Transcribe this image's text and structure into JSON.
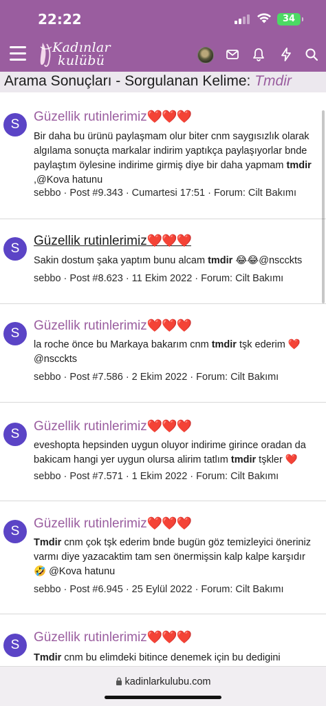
{
  "status": {
    "time": "22:22",
    "battery": "34"
  },
  "header": {
    "logo_line1": "Kadınlar",
    "logo_line2": "kulübü"
  },
  "page": {
    "title_prefix": "Arama Sonuçları - Sorgulanan Kelime: ",
    "search_term": "Tmdir"
  },
  "results": [
    {
      "avatar_letter": "S",
      "title": "Güzellik rutinlerimiz",
      "hearts": "❤️❤️❤️",
      "snippet_before": "Bir daha bu ürünü paylaşmam olur biter cnm saygısızlık olarak algılama sonuçta markalar indirim yaptıkça paylaşıyorlar bnde paylaştım öylesine indirime girmiş diye bir daha yapmam ",
      "snippet_bold": "tmdir",
      "snippet_after": " ,@Kova hatunu",
      "meta": "sebbo · Post #9.343 · Cumartesi 17:51 · Forum: Cilt Bakımı"
    },
    {
      "avatar_letter": "S",
      "title": "Güzellik rutinlerimiz",
      "hearts": "❤️❤️❤️",
      "snippet_before": "Sakin dostum şaka yaptım bunu alcam ",
      "snippet_bold": "tmdir",
      "snippet_after": " 😂😂@nscckts",
      "meta": "sebbo · Post #8.623 · 11 Ekim 2022 · Forum: Cilt Bakımı"
    },
    {
      "avatar_letter": "S",
      "title": "Güzellik rutinlerimiz",
      "hearts": "❤️❤️❤️",
      "snippet_before": "la roche önce bu Markaya bakarım cnm ",
      "snippet_bold": "tmdir",
      "snippet_after": " tşk ederim ❤️ @nscckts",
      "meta": "sebbo · Post #7.586 · 2 Ekim 2022 · Forum: Cilt Bakımı"
    },
    {
      "avatar_letter": "S",
      "title": "Güzellik rutinlerimiz",
      "hearts": "❤️❤️❤️",
      "snippet_before": "eveshopta hepsinden uygun oluyor indirime girince oradan da bakicam hangi yer uygun olursa alirim tatlım ",
      "snippet_bold": "tmdir",
      "snippet_after": " tşkler ❤️",
      "meta": "sebbo · Post #7.571 · 1 Ekim 2022 · Forum: Cilt Bakımı"
    },
    {
      "avatar_letter": "S",
      "title": "Güzellik rutinlerimiz",
      "hearts": "❤️❤️❤️",
      "snippet_before": "",
      "snippet_bold": "Tmdir",
      "snippet_after": " cnm çok tşk ederim bnde bugün göz temizleyici öneriniz varmı diye yazacaktim tam sen önermişsin kalp kalpe karşıdır 🤣 @Kova hatunu",
      "meta": "sebbo · Post #6.945 · 25 Eylül 2022 · Forum: Cilt Bakımı"
    },
    {
      "avatar_letter": "S",
      "title": "Güzellik rutinlerimiz",
      "hearts": "❤️❤️❤️",
      "snippet_before": "",
      "snippet_bold": "Tmdir",
      "snippet_after": " cnm bu elimdeki bitince denemek için bu dedigini",
      "meta": ""
    }
  ],
  "url_bar": {
    "url": "kadinlarkulubu.com"
  }
}
